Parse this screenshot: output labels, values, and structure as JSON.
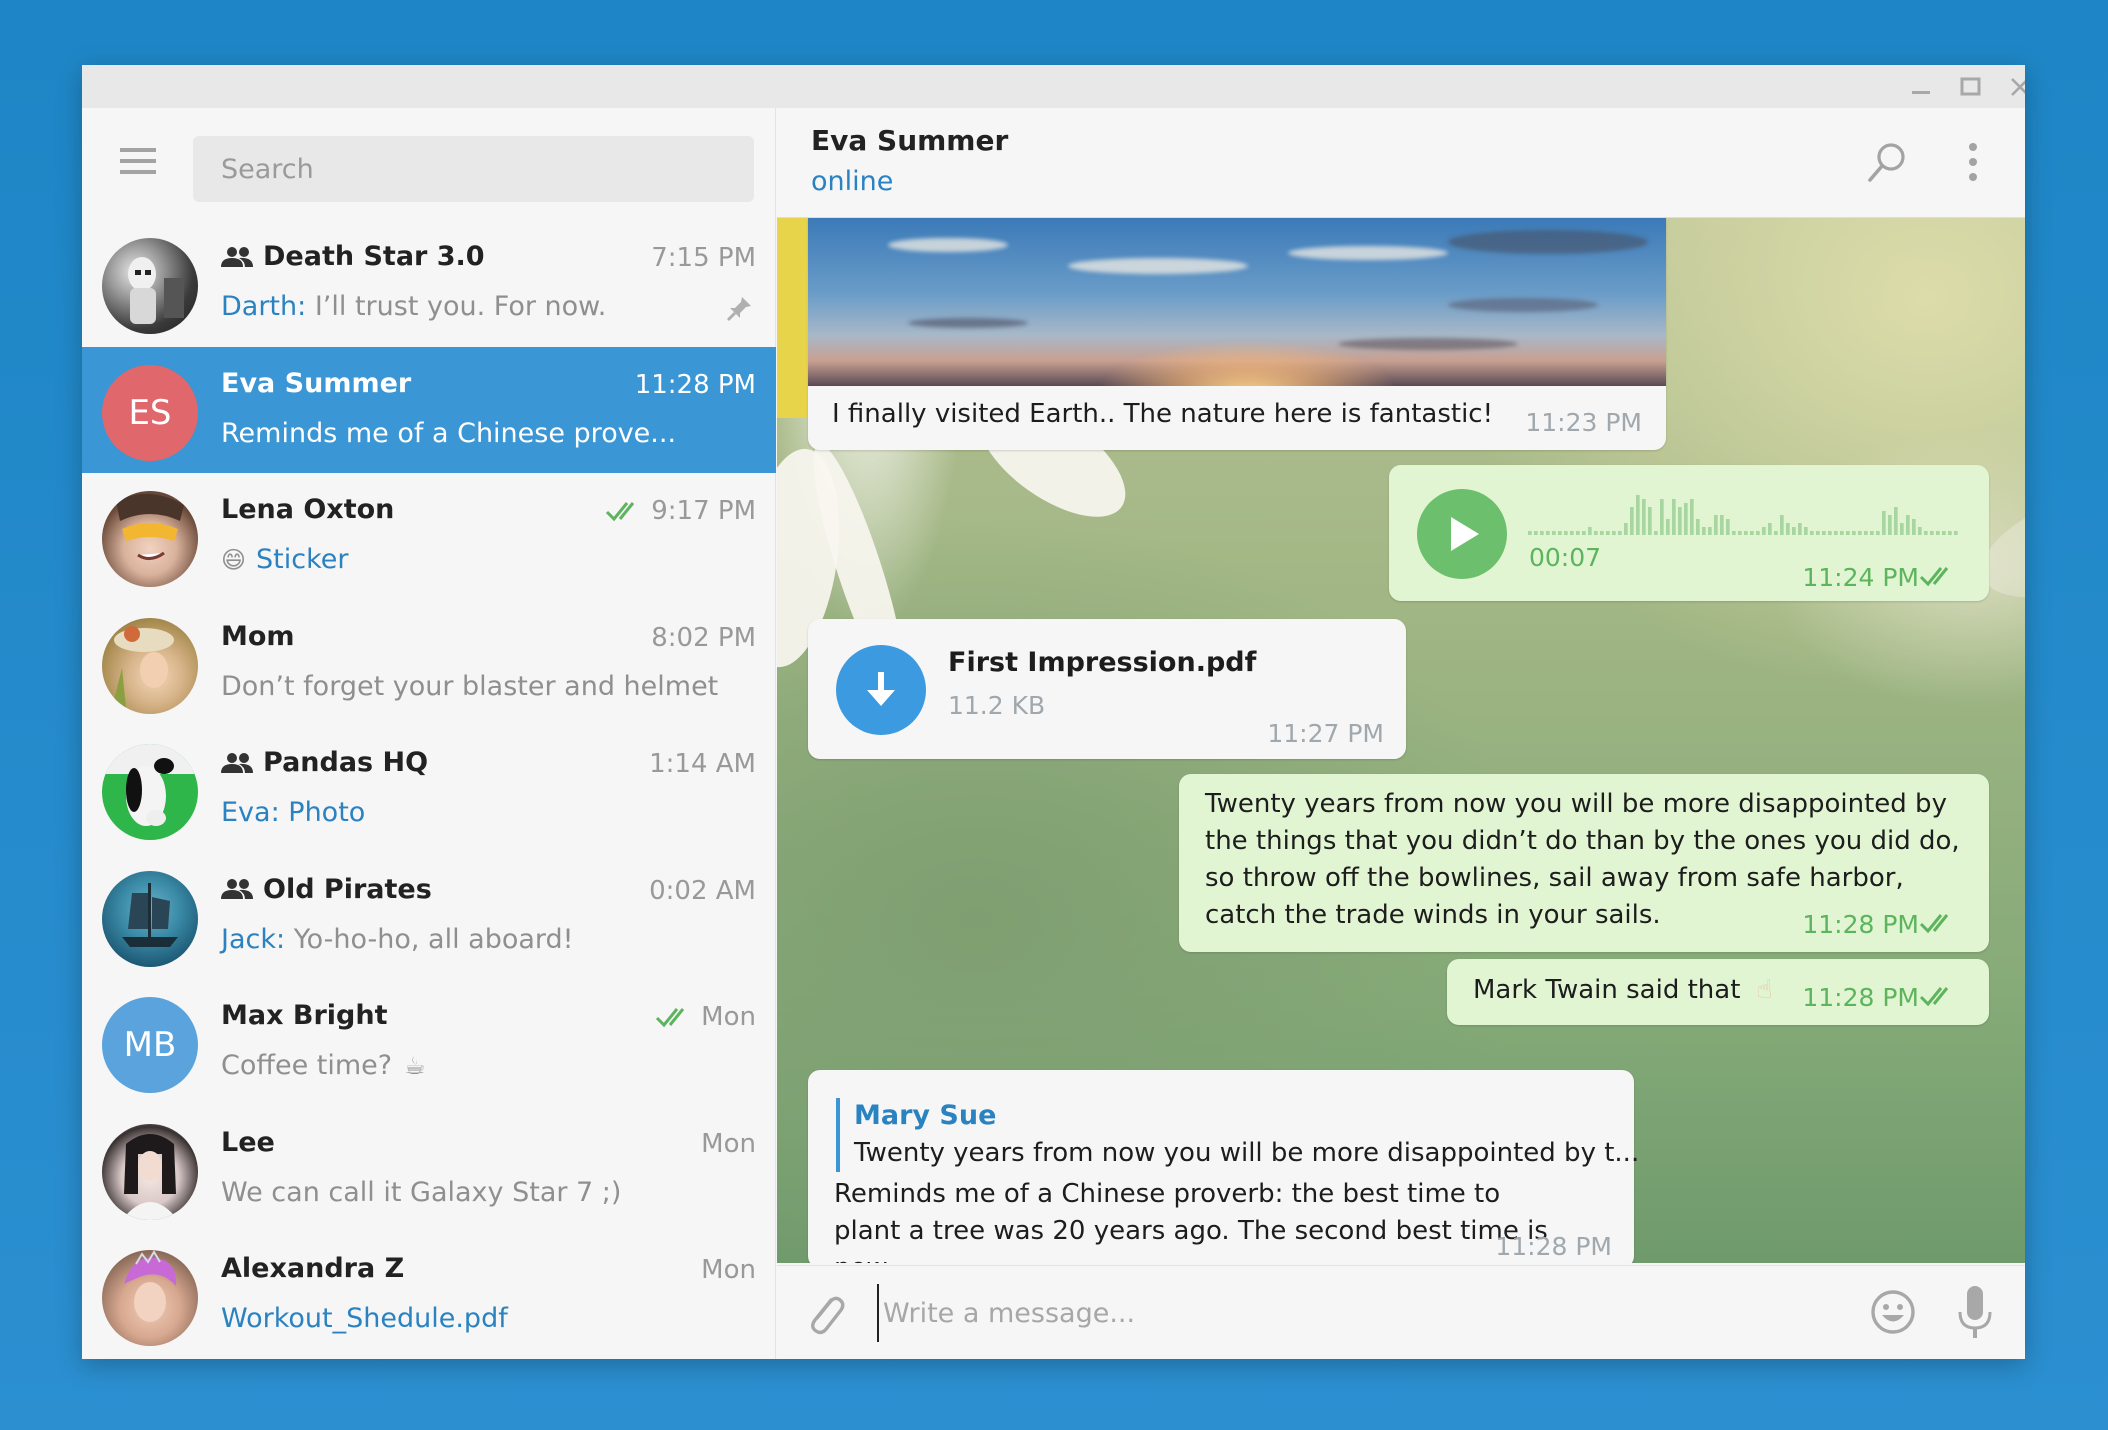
{
  "window": {
    "controls": [
      "minimize",
      "maximize",
      "close"
    ]
  },
  "sidebar": {
    "search_placeholder": "Search",
    "chats": [
      {
        "name": "Death Star 3.0",
        "is_group": true,
        "time": "7:15 PM",
        "author": "Darth:",
        "preview": "I’ll trust you. For now.",
        "pinned": true,
        "avatar": "stormtrooper-photo"
      },
      {
        "name": "Eva Summer",
        "is_group": false,
        "time": "11:28 PM",
        "preview": "Reminds me of a Chinese prove...",
        "active": true,
        "initials": "ES",
        "avatar_color": "#e0676b"
      },
      {
        "name": "Lena Oxton",
        "is_group": false,
        "time": "9:17 PM",
        "read": true,
        "preview": "Sticker",
        "preview_emoji": "😄",
        "avatar": "cartoon-girl"
      },
      {
        "name": "Mom",
        "is_group": false,
        "time": "8:02 PM",
        "preview": "Don’t forget your blaster and helmet",
        "avatar": "vintage-painting"
      },
      {
        "name": "Pandas HQ",
        "is_group": true,
        "time": "1:14 AM",
        "author": "Eva:",
        "preview": "Photo",
        "avatar": "panda-photo"
      },
      {
        "name": "Old Pirates",
        "is_group": true,
        "time": "0:02 AM",
        "author": "Jack:",
        "preview": "Yo-ho-ho, all aboard!",
        "avatar": "ship-painting"
      },
      {
        "name": "Max Bright",
        "is_group": false,
        "time": "Mon",
        "read": true,
        "preview": "Coffee time?",
        "preview_emoji_after": "☕",
        "initials": "MB",
        "avatar_color": "#5aa3dc"
      },
      {
        "name": "Lee",
        "is_group": false,
        "time": "Mon",
        "preview": "We can call it Galaxy Star 7 ;)",
        "avatar": "girl-photo"
      },
      {
        "name": "Alexandra Z",
        "is_group": false,
        "time": "Mon",
        "preview": "Workout_Shedule.pdf",
        "preview_is_file": true,
        "avatar": "pink-hair-photo"
      }
    ]
  },
  "chat": {
    "title": "Eva Summer",
    "status": "online",
    "messages": {
      "photo": {
        "caption": "I finally visited Earth.. The nature here is fantastic!",
        "time": "11:23 PM"
      },
      "voice": {
        "duration": "00:07",
        "time": "11:24 PM",
        "read": true
      },
      "file": {
        "name": "First Impression.pdf",
        "size": "11.2 KB",
        "time": "11:27 PM"
      },
      "quote": {
        "text": "Twenty years from now you will be more disappointed by the things that you didn’t do than by the ones you did do, so throw off the bowlines, sail away from safe harbor, catch the trade winds in your sails.",
        "time": "11:28 PM",
        "read": true
      },
      "twain": {
        "text": "Mark Twain said that",
        "emoji": "☝",
        "time": "11:28 PM",
        "read": true
      },
      "reply": {
        "reply_author": "Mary Sue",
        "reply_snippet": "Twenty years from now you will be more disappointed by t...",
        "text": "Reminds me of a Chinese proverb: the best time to plant a tree was 20 years ago. The second best time is now.",
        "time": "11:28 PM"
      }
    },
    "composer_placeholder": "Write a message..."
  },
  "colors": {
    "accent": "#3a96d4",
    "link": "#2a82c1",
    "outgoing_bubble": "#e2f5d3",
    "outgoing_time": "#5cb45c",
    "desktop_bg": "#1e86c6"
  }
}
